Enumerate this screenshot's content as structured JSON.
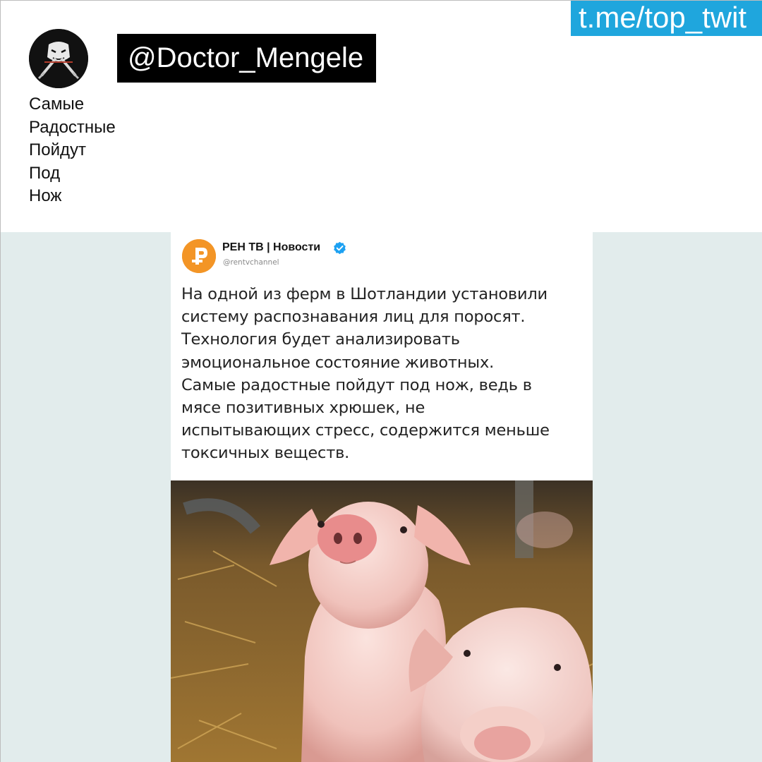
{
  "channel_link": "t.me/top_twit",
  "post": {
    "username": "@Doctor_Mengele",
    "caption_lines": [
      "Самые",
      "Радостные",
      "Пойдут",
      "Под",
      "Нож"
    ]
  },
  "tweet": {
    "author_name": "РЕН ТВ | Новости",
    "handle": "@rentvchannel",
    "text_lines": [
      "На одной из ферм в Шотландии установили",
      "систему распознавания лиц для поросят.",
      "Технология будет анализировать",
      "эмоциональное состояние животных.",
      "Самые радостные пойдут под нож, ведь в",
      "мясе позитивных хрюшек, не",
      "испытывающих стресс, содержится меньше",
      "токсичных веществ."
    ]
  },
  "colors": {
    "channel_link_bg": "#1fa6dd",
    "username_badge_bg": "#000000",
    "background_lower": "#e2ecec",
    "rentv_logo": "#f39526",
    "verified_badge": "#1da1f2"
  },
  "icons": {
    "avatar": "masked-figure-avatar-icon",
    "tweet_logo": "rentv-logo-icon",
    "verified": "verified-badge-icon"
  }
}
